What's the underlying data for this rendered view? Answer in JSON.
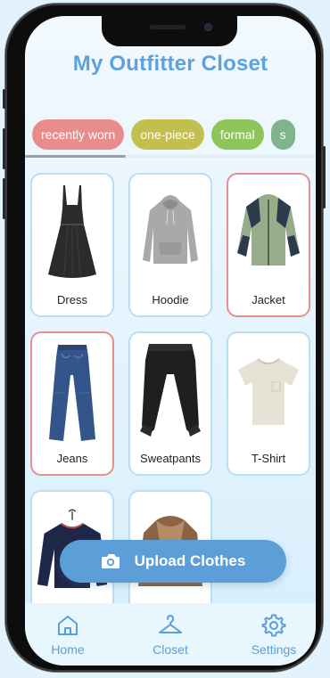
{
  "app": {
    "title": "My Outfitter Closet"
  },
  "filters": [
    {
      "label": "recently worn",
      "color": "#e98c8c"
    },
    {
      "label": "one-piece",
      "color": "#c3bf4f"
    },
    {
      "label": "formal",
      "color": "#8ec45a"
    },
    {
      "label": "s",
      "color": "#7fb48c"
    }
  ],
  "items": [
    {
      "label": "Dress",
      "selected": false,
      "icon": "dress-image"
    },
    {
      "label": "Hoodie",
      "selected": false,
      "icon": "hoodie-image"
    },
    {
      "label": "Jacket",
      "selected": true,
      "icon": "jacket-image"
    },
    {
      "label": "Jeans",
      "selected": true,
      "icon": "jeans-image"
    },
    {
      "label": "Sweatpants",
      "selected": false,
      "icon": "sweatpants-image"
    },
    {
      "label": "T-Shirt",
      "selected": false,
      "icon": "tshirt-image"
    },
    {
      "label": "",
      "selected": false,
      "icon": "sweater-image"
    },
    {
      "label": "",
      "selected": false,
      "icon": "fur-coat-image"
    }
  ],
  "upload": {
    "label": "Upload Clothes",
    "icon": "camera-icon"
  },
  "tabs": [
    {
      "label": "Home",
      "icon": "home-icon"
    },
    {
      "label": "Closet",
      "icon": "hanger-icon"
    },
    {
      "label": "Settings",
      "icon": "gear-icon"
    }
  ],
  "colors": {
    "accent": "#5c9fd8",
    "card_border": "#b9dff3",
    "selected_border": "#e68f8f"
  }
}
